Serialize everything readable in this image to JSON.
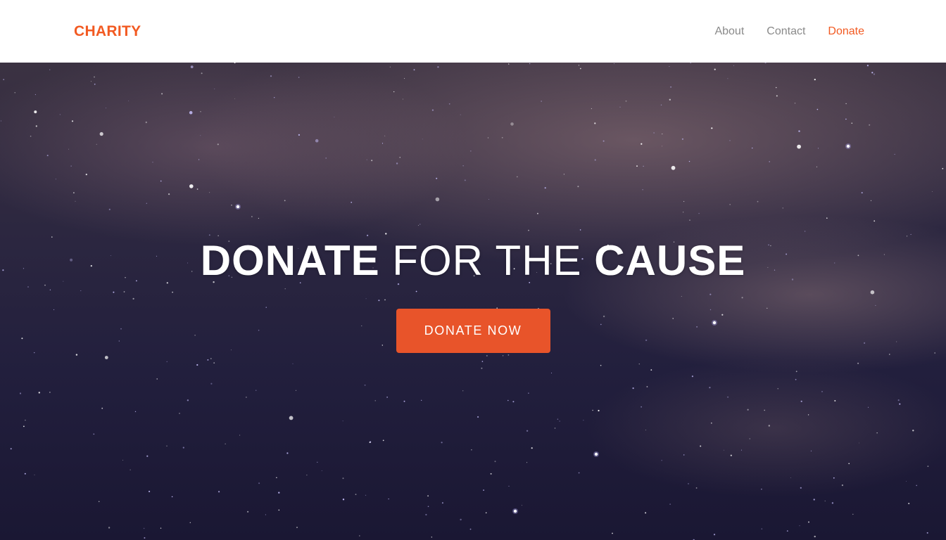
{
  "colors": {
    "accent": "#f25a22",
    "button_bg": "#e8542a",
    "nav_text": "#8a8a8a",
    "nav_bg": "#ffffff",
    "hero_text": "#ffffff"
  },
  "header": {
    "brand": "CHARITY",
    "nav": [
      {
        "label": "About",
        "active": false
      },
      {
        "label": "Contact",
        "active": false
      },
      {
        "label": "Donate",
        "active": true
      }
    ]
  },
  "hero": {
    "headline": {
      "part1": "DONATE",
      "part2": " FOR THE ",
      "part3": "CAUSE"
    },
    "cta_label": "DONATE NOW"
  }
}
